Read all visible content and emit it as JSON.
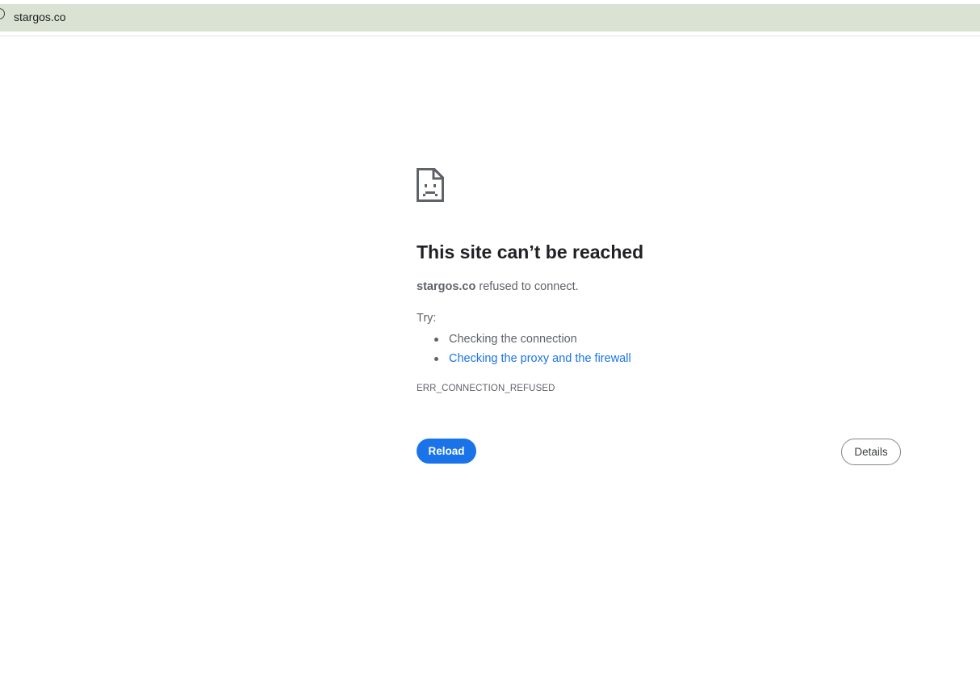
{
  "browser": {
    "url": "stargos.co",
    "bar_color": "#dae3d3"
  },
  "error": {
    "icon": "sad-document-icon",
    "title": "This site can’t be reached",
    "host": "stargos.co",
    "message_suffix": " refused to connect.",
    "try_label": "Try:",
    "suggestions": [
      {
        "text": "Checking the connection",
        "is_link": false
      },
      {
        "text": "Checking the proxy and the firewall",
        "is_link": true
      }
    ],
    "code": "ERR_CONNECTION_REFUSED"
  },
  "buttons": {
    "reload": "Reload",
    "details": "Details"
  },
  "colors": {
    "accent": "#1a73e8",
    "text_secondary": "#5f6368",
    "title": "#202124"
  }
}
